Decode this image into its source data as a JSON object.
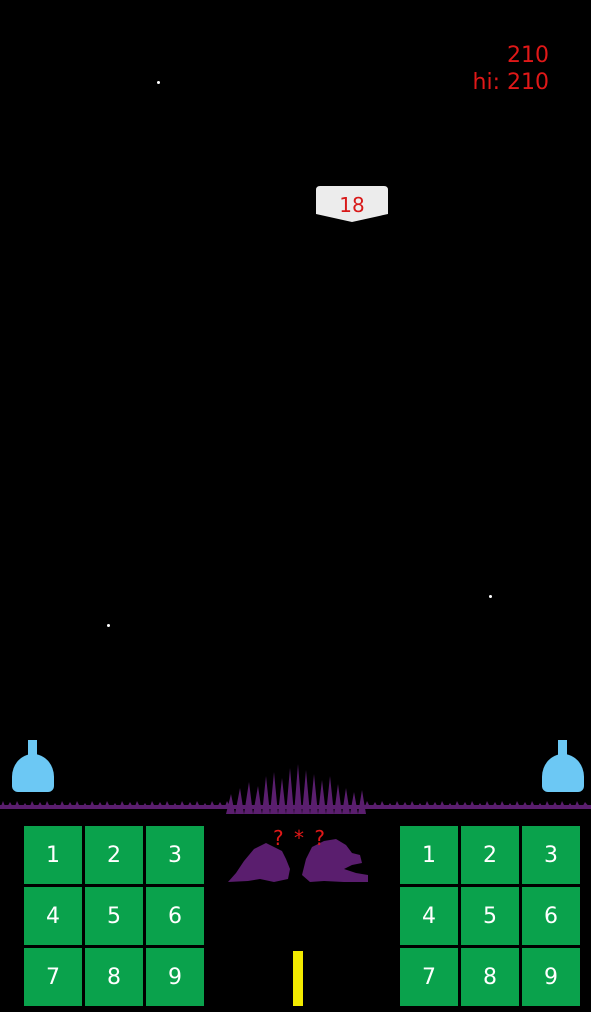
{
  "hud": {
    "score": "210",
    "hiscore": "hi: 210"
  },
  "target": {
    "value": "18"
  },
  "equation": "? * ?",
  "keypad_left": [
    "1",
    "2",
    "3",
    "4",
    "5",
    "6",
    "7",
    "8",
    "9"
  ],
  "keypad_right": [
    "1",
    "2",
    "3",
    "4",
    "5",
    "6",
    "7",
    "8",
    "9"
  ],
  "colors": {
    "background": "#000000",
    "score": "#e01818",
    "key": "#0aa24c",
    "cannon": "#6cc8f4",
    "ground": "#5a1e6e",
    "timer": "#f2ea00"
  }
}
